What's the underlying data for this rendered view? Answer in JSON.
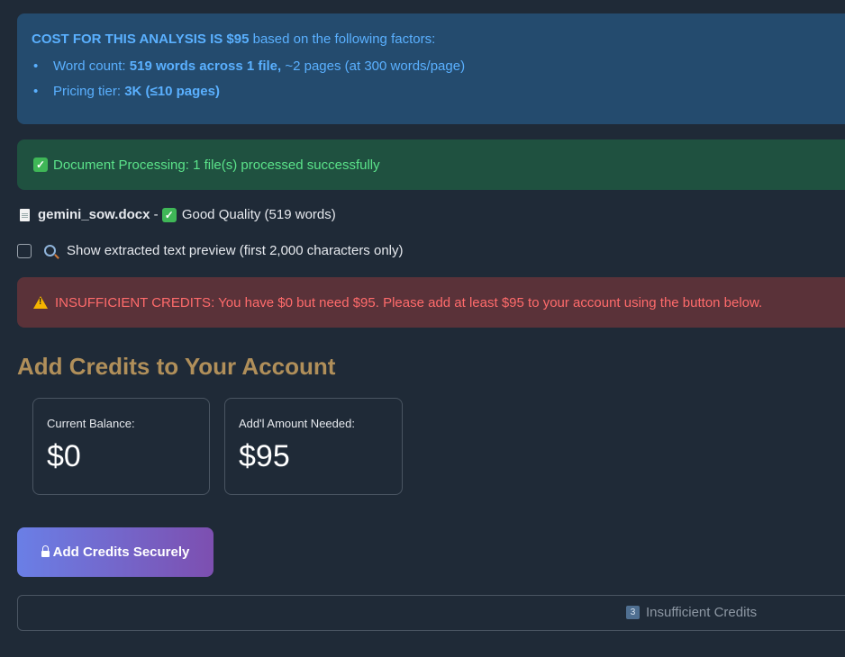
{
  "info": {
    "head_bold": "COST FOR THIS ANALYSIS IS $95",
    "head_rest": " based on the following factors:",
    "word_count_label": "Word count: ",
    "word_count_bold": "519 words across 1 file,",
    "word_count_rest": " ~2 pages (at 300 words/page)",
    "tier_label": "Pricing tier: ",
    "tier_bold": "3K (≤10 pages)"
  },
  "success": {
    "text": "Document Processing: 1 file(s) processed successfully"
  },
  "file": {
    "name": "gemini_sow.docx",
    "separator": " - ",
    "quality": "Good Quality (519 words)"
  },
  "preview": {
    "label": "Show extracted text preview (first 2,000 characters only)",
    "checked": false
  },
  "error": {
    "text": "INSUFFICIENT CREDITS: You have $0 but need $95. Please add at least $95 to your account using the button below."
  },
  "section": {
    "heading": "Add Credits to Your Account"
  },
  "metrics": {
    "balance_label": "Current Balance:",
    "balance_value": "$0",
    "needed_label": "Add'l Amount Needed:",
    "needed_value": "$95"
  },
  "button": {
    "label": "Add Credits Securely"
  },
  "bottom": {
    "step": "3",
    "label": "Insufficient Credits"
  },
  "colors": {
    "info_bg": "#244b6e",
    "success_bg": "#1f5140",
    "error_bg": "#5a3239",
    "heading": "#b08f5a",
    "button_from": "#6a7fe6",
    "button_to": "#7d4fb0"
  }
}
